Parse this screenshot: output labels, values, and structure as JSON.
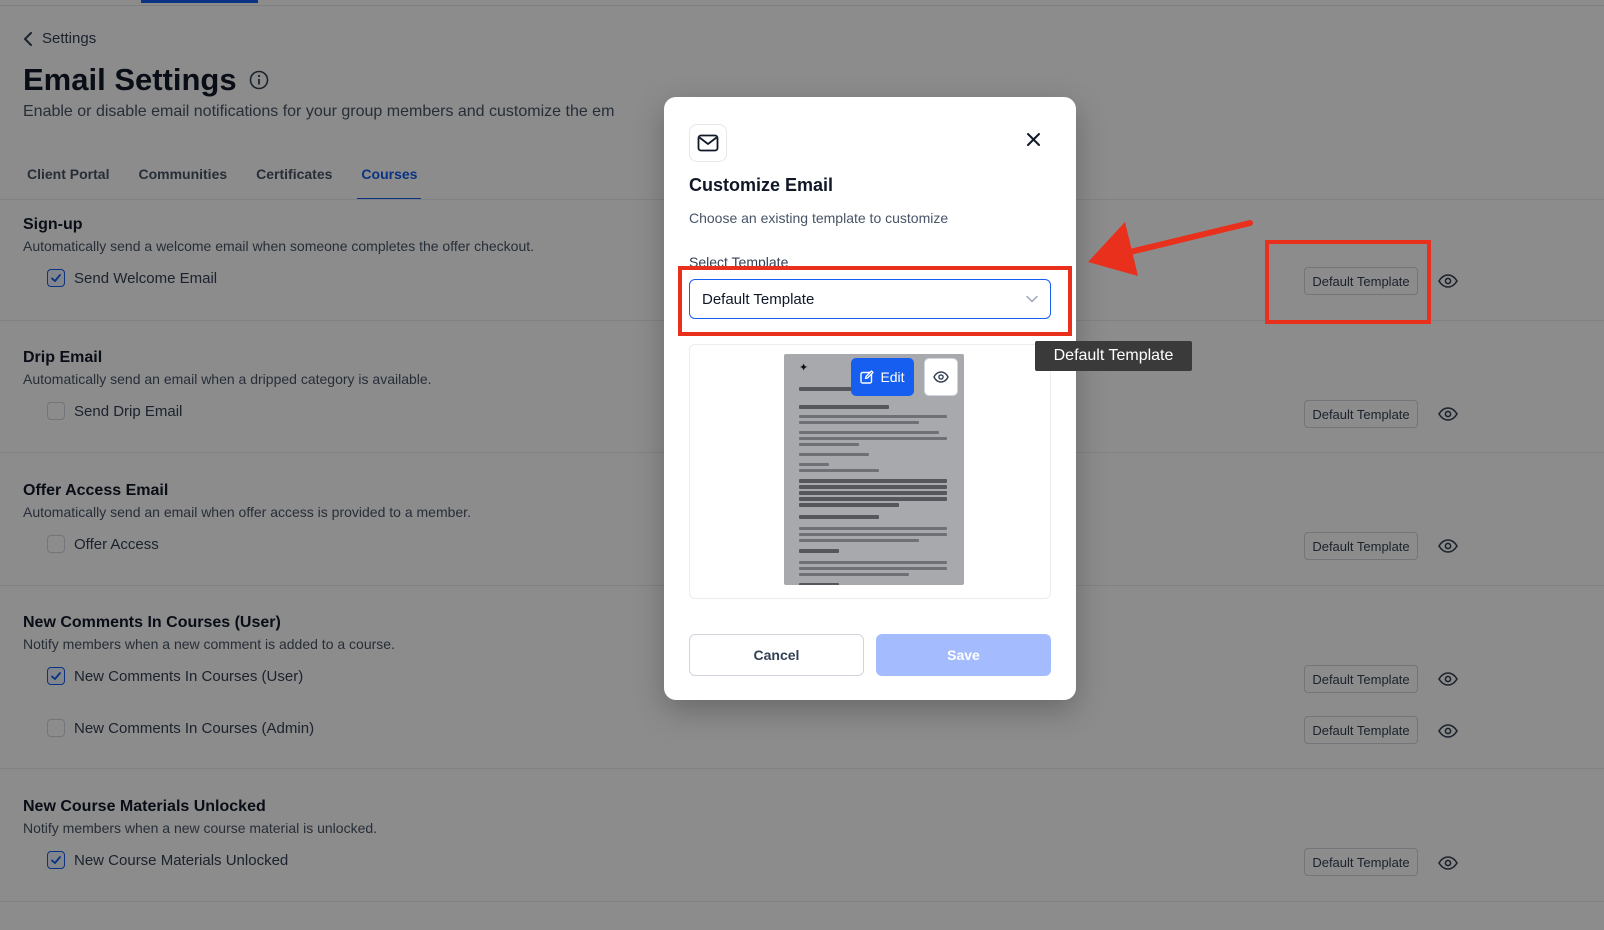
{
  "nav": {
    "back_label": "Settings"
  },
  "header": {
    "title": "Email Settings",
    "description": "Enable or disable email notifications for your group members and customize the em"
  },
  "tabs": [
    {
      "label": "Client Portal"
    },
    {
      "label": "Communities"
    },
    {
      "label": "Certificates"
    },
    {
      "label": "Courses",
      "active": true
    }
  ],
  "sections": [
    {
      "title": "Sign-up",
      "description": "Automatically send a welcome email when someone completes the offer checkout.",
      "items": [
        {
          "label": "Send Welcome Email",
          "checked": true,
          "template": "Default Template"
        }
      ]
    },
    {
      "title": "Drip Email",
      "description": "Automatically send an email when a dripped category is available.",
      "items": [
        {
          "label": "Send Drip Email",
          "checked": false,
          "template": "Default Template"
        }
      ]
    },
    {
      "title": "Offer Access Email",
      "description": "Automatically send an email when offer access is provided to a member.",
      "items": [
        {
          "label": "Offer Access",
          "checked": false,
          "template": "Default Template"
        }
      ]
    },
    {
      "title": "New Comments In Courses (User)",
      "description": "Notify members when a new comment is added to a course.",
      "items": [
        {
          "label": "New Comments In Courses (User)",
          "checked": true,
          "template": "Default Template"
        },
        {
          "label": "New Comments In Courses (Admin)",
          "checked": false,
          "template": "Default Template"
        }
      ]
    },
    {
      "title": "New Course Materials Unlocked",
      "description": "Notify members when a new course material is unlocked.",
      "items": [
        {
          "label": "New Course Materials Unlocked",
          "checked": true,
          "template": "Default Template"
        }
      ]
    }
  ],
  "modal": {
    "title": "Customize Email",
    "subtitle": "Choose an existing template to customize",
    "select_label": "Select Template",
    "select_value": "Default Template",
    "edit_label": "Edit",
    "cancel_label": "Cancel",
    "save_label": "Save"
  },
  "tooltip": {
    "text": "Default Template"
  },
  "colors": {
    "accent": "#155eef",
    "annotation": "#e8301c",
    "save_disabled": "#a4bcfd"
  },
  "icons": [
    "chevron-left-icon",
    "info-icon",
    "check-icon",
    "eye-icon",
    "mail-icon",
    "close-icon",
    "chevron-down-icon",
    "edit-icon",
    "red-arrow-annotation"
  ]
}
